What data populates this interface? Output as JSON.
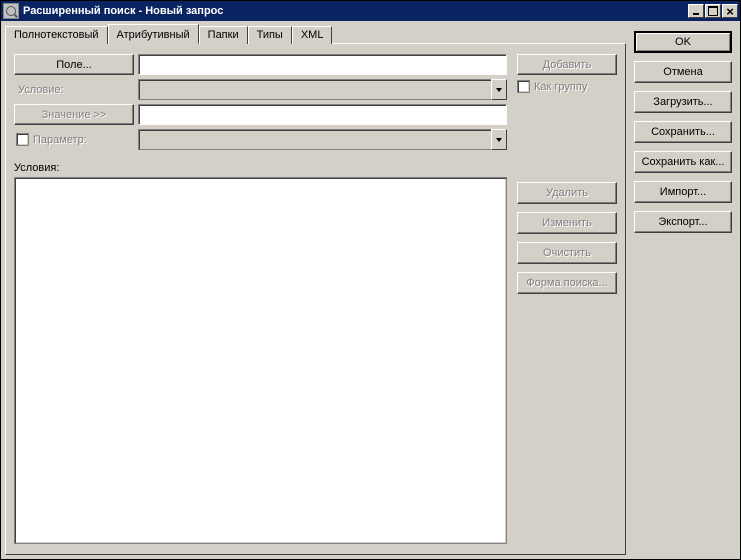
{
  "window": {
    "title": "Расширенный поиск - Новый запрос"
  },
  "controls": {
    "min": "_",
    "max": "□",
    "close": "×"
  },
  "tabs": [
    {
      "label": "Полнотекстовый",
      "active": false
    },
    {
      "label": "Атрибутивный",
      "active": true
    },
    {
      "label": "Папки",
      "active": false
    },
    {
      "label": "Типы",
      "active": false
    },
    {
      "label": "XML",
      "active": false
    }
  ],
  "form": {
    "fieldBtn": "Поле...",
    "conditionLabel": "Условие:",
    "valueBtn": "Значение >>",
    "paramLabel": "Параметр:",
    "conditionsLabel": "Условия:"
  },
  "addArea": {
    "addBtn": "Добавить",
    "asGroupLabel": "Как группу"
  },
  "rightLocal": {
    "delete": "Удалить",
    "edit": "Изменить",
    "clear": "Очистить",
    "searchForm": "Форма поиска..."
  },
  "rightGlobal": {
    "ok": "OK",
    "cancel": "Отмена",
    "load": "Загрузить...",
    "save": "Сохранить...",
    "saveAs": "Сохранить как...",
    "import": "Импорт...",
    "export": "Экспорт..."
  }
}
